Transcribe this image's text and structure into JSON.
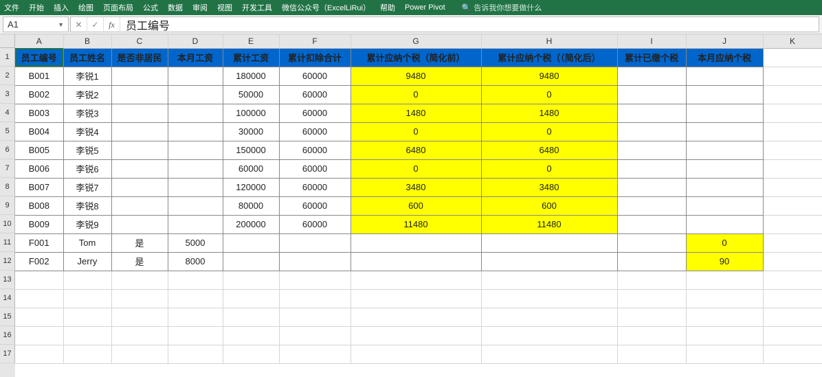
{
  "ribbon": {
    "tabs": [
      "文件",
      "开始",
      "插入",
      "绘图",
      "页面布局",
      "公式",
      "数据",
      "审阅",
      "视图",
      "开发工具",
      "微信公众号（ExcelLiRui）",
      "帮助",
      "Power Pivot"
    ],
    "search_placeholder": "告诉我你想要做什么"
  },
  "namebox": {
    "ref": "A1"
  },
  "formula_bar": {
    "value": "员工编号"
  },
  "columns": [
    "A",
    "B",
    "C",
    "D",
    "E",
    "F",
    "G",
    "H",
    "I",
    "J",
    "K"
  ],
  "row_headers": [
    "1",
    "2",
    "3",
    "4",
    "5",
    "6",
    "7",
    "8",
    "9",
    "10",
    "11",
    "12",
    "13",
    "14",
    "15",
    "16",
    "17"
  ],
  "table": {
    "headers": [
      "员工编号",
      "员工姓名",
      "是否非居民",
      "本月工资",
      "累计工资",
      "累计扣除合计",
      "累计应纳个税（简化前）",
      "累计应纳个税（（简化后）",
      "累计已缴个税",
      "本月应纳个税"
    ],
    "rows": [
      {
        "A": "B001",
        "B": "李锐1",
        "C": "",
        "D": "",
        "E": "180000",
        "F": "60000",
        "G": "9480",
        "H": "9480",
        "I": "",
        "J": ""
      },
      {
        "A": "B002",
        "B": "李锐2",
        "C": "",
        "D": "",
        "E": "50000",
        "F": "60000",
        "G": "0",
        "H": "0",
        "I": "",
        "J": ""
      },
      {
        "A": "B003",
        "B": "李锐3",
        "C": "",
        "D": "",
        "E": "100000",
        "F": "60000",
        "G": "1480",
        "H": "1480",
        "I": "",
        "J": ""
      },
      {
        "A": "B004",
        "B": "李锐4",
        "C": "",
        "D": "",
        "E": "30000",
        "F": "60000",
        "G": "0",
        "H": "0",
        "I": "",
        "J": ""
      },
      {
        "A": "B005",
        "B": "李锐5",
        "C": "",
        "D": "",
        "E": "150000",
        "F": "60000",
        "G": "6480",
        "H": "6480",
        "I": "",
        "J": ""
      },
      {
        "A": "B006",
        "B": "李锐6",
        "C": "",
        "D": "",
        "E": "60000",
        "F": "60000",
        "G": "0",
        "H": "0",
        "I": "",
        "J": ""
      },
      {
        "A": "B007",
        "B": "李锐7",
        "C": "",
        "D": "",
        "E": "120000",
        "F": "60000",
        "G": "3480",
        "H": "3480",
        "I": "",
        "J": ""
      },
      {
        "A": "B008",
        "B": "李锐8",
        "C": "",
        "D": "",
        "E": "80000",
        "F": "60000",
        "G": "600",
        "H": "600",
        "I": "",
        "J": ""
      },
      {
        "A": "B009",
        "B": "李锐9",
        "C": "",
        "D": "",
        "E": "200000",
        "F": "60000",
        "G": "11480",
        "H": "11480",
        "I": "",
        "J": ""
      },
      {
        "A": "F001",
        "B": "Tom",
        "C": "是",
        "D": "5000",
        "E": "",
        "F": "",
        "G": "",
        "H": "",
        "I": "",
        "J": "0"
      },
      {
        "A": "F002",
        "B": "Jerry",
        "C": "是",
        "D": "8000",
        "E": "",
        "F": "",
        "G": "",
        "H": "",
        "I": "",
        "J": "90"
      }
    ],
    "highlight_cols_domestic": [
      "G",
      "H"
    ],
    "highlight_cols_foreign": [
      "J"
    ]
  }
}
